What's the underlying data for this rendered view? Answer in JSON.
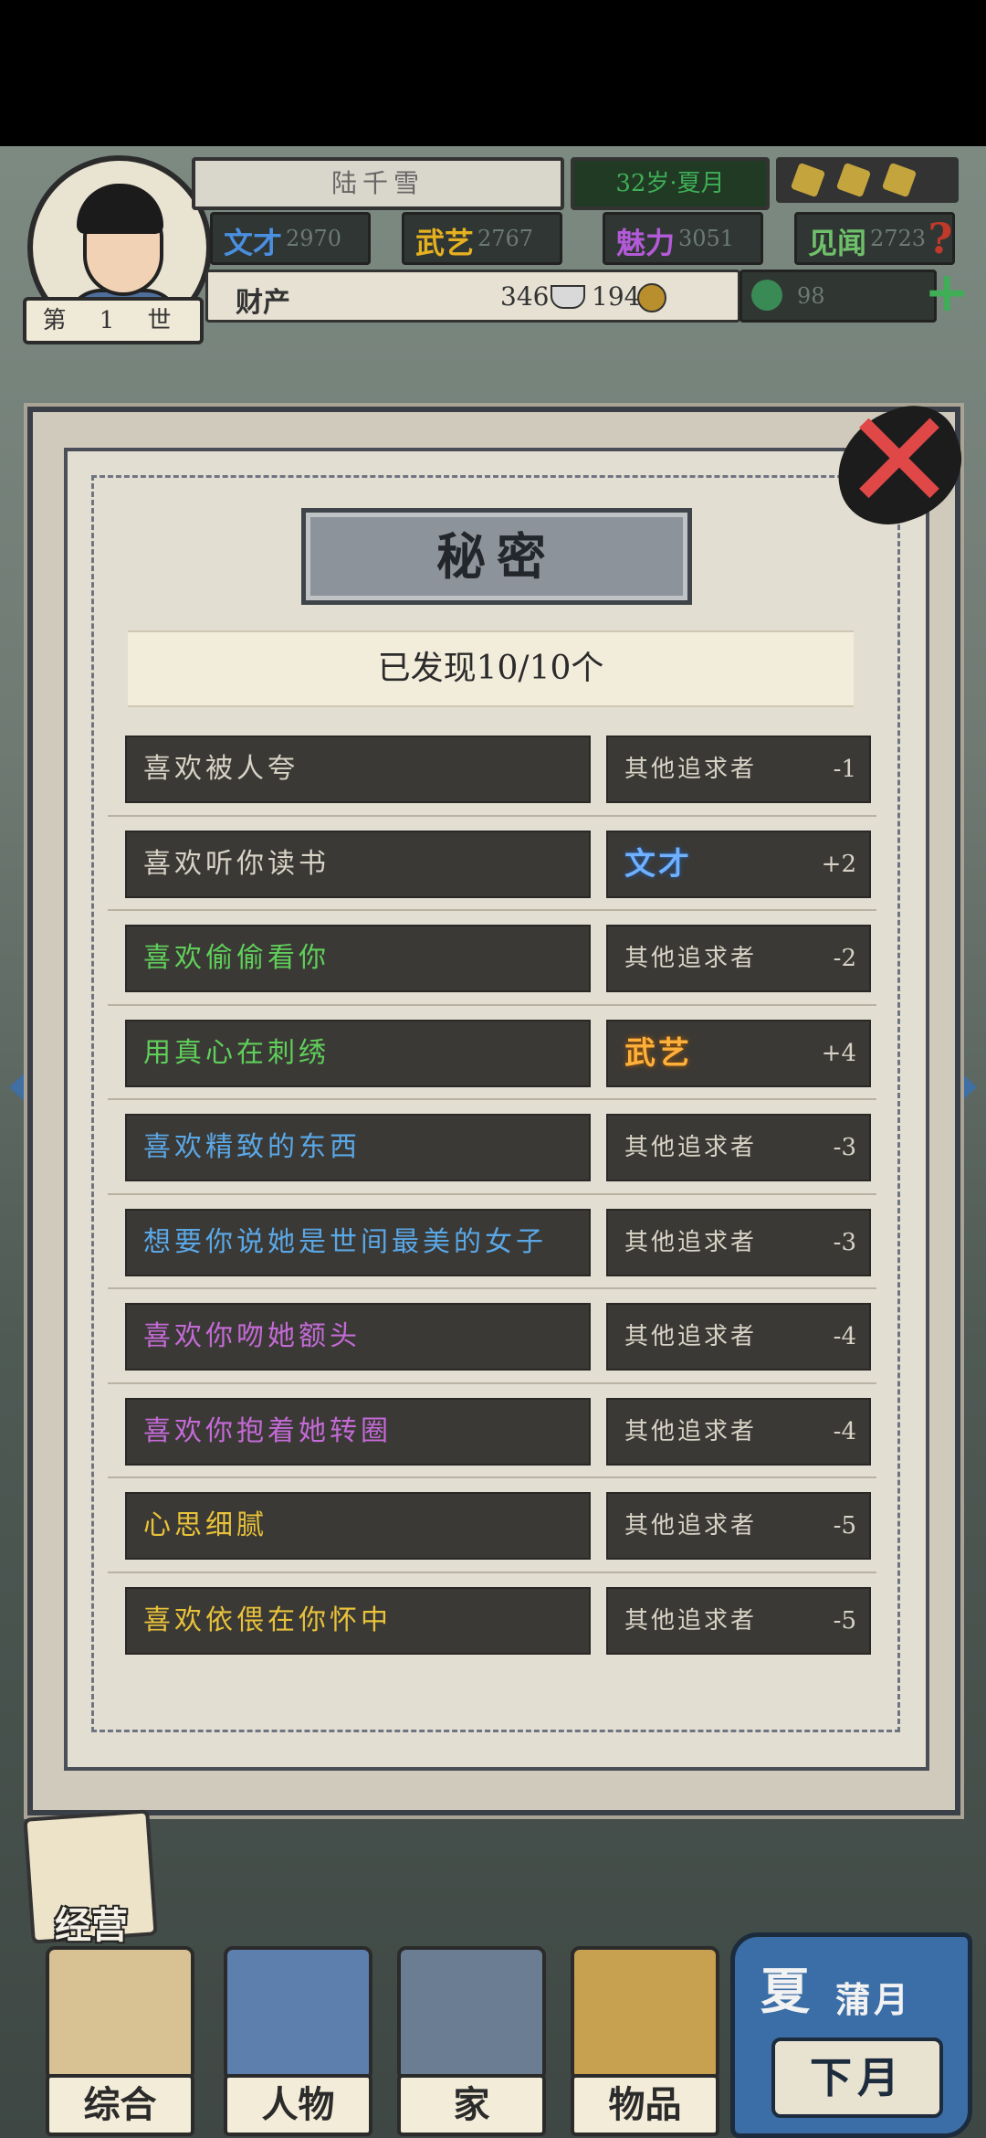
{
  "player": {
    "name": "陆千雪",
    "age": "32岁·夏月",
    "generation": "第 1 世"
  },
  "stats": [
    {
      "label": "文才",
      "value": "2970",
      "color": "#4a8fe0"
    },
    {
      "label": "武艺",
      "value": "2767",
      "color": "#e6b020"
    },
    {
      "label": "魅力",
      "value": "3051",
      "color": "#b35ad8"
    },
    {
      "label": "见闻",
      "value": "2723",
      "color": "#6fc06a"
    }
  ],
  "wealth": {
    "label": "财产",
    "silver": "346",
    "coin": "194"
  },
  "lucky": {
    "value": "98"
  },
  "dialog": {
    "title": "秘密",
    "found": "已发现10/10个",
    "secrets": [
      {
        "text": "喜欢被人夸",
        "color": "#d8d3c6",
        "effect": "其他追求者",
        "effect_style": "plain",
        "delta": "-1"
      },
      {
        "text": "喜欢听你读书",
        "color": "#d8d3c6",
        "effect": "文才",
        "effect_style": "blue",
        "delta": "+2"
      },
      {
        "text": "喜欢偷偷看你",
        "color": "#5fcf5a",
        "effect": "其他追求者",
        "effect_style": "plain",
        "delta": "-2"
      },
      {
        "text": "用真心在刺绣",
        "color": "#5fcf5a",
        "effect": "武艺",
        "effect_style": "gold",
        "delta": "+4"
      },
      {
        "text": "喜欢精致的东西",
        "color": "#5aa7e6",
        "effect": "其他追求者",
        "effect_style": "plain",
        "delta": "-3"
      },
      {
        "text": "想要你说她是世间最美的女子",
        "color": "#5aa7e6",
        "effect": "其他追求者",
        "effect_style": "plain",
        "delta": "-3"
      },
      {
        "text": "喜欢你吻她额头",
        "color": "#c36ad6",
        "effect": "其他追求者",
        "effect_style": "plain",
        "delta": "-4"
      },
      {
        "text": "喜欢你抱着她转圈",
        "color": "#c36ad6",
        "effect": "其他追求者",
        "effect_style": "plain",
        "delta": "-4"
      },
      {
        "text": "心思细腻",
        "color": "#e8c23a",
        "effect": "其他追求者",
        "effect_style": "plain",
        "delta": "-5"
      },
      {
        "text": "喜欢依偎在你怀中",
        "color": "#e8c23a",
        "effect": "其他追求者",
        "effect_style": "plain",
        "delta": "-5"
      }
    ]
  },
  "bottom_nav": {
    "manage": "经营",
    "items": [
      "综合",
      "人物",
      "家",
      "物品"
    ],
    "season": "夏",
    "month": "蒲月",
    "next": "下月"
  }
}
